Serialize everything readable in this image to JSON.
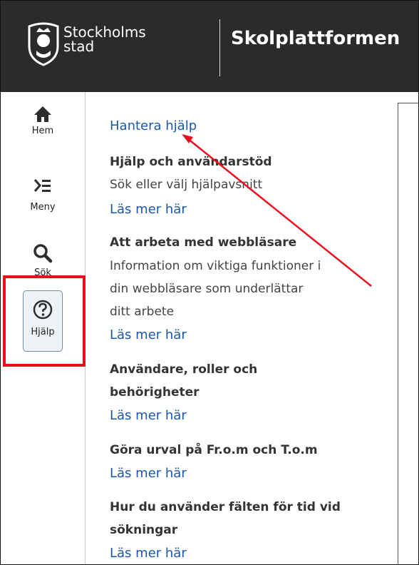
{
  "header": {
    "logo_line1": "Stockholms",
    "logo_line2": "stad",
    "app_title": "Skolplattformen"
  },
  "sidebar": {
    "items": [
      {
        "label": "Hem",
        "icon": "home-icon"
      },
      {
        "label": "Meny",
        "icon": "menu-icon"
      },
      {
        "label": "Sök",
        "icon": "search-icon"
      },
      {
        "label": "Hjälp",
        "icon": "help-icon"
      }
    ]
  },
  "help": {
    "manage_link": "Hantera hjälp",
    "sections": [
      {
        "title": "Hjälp och användarstöd",
        "desc": [
          "Sök eller välj hjälpavsnitt"
        ],
        "link": "Läs mer här"
      },
      {
        "title": "Att arbeta med webbläsare",
        "desc": [
          "Information om viktiga funktioner i",
          "din webbläsare som underlättar",
          "ditt arbete"
        ],
        "link": "Läs mer här"
      },
      {
        "title": "Användare, roller och",
        "title2": "behörigheter",
        "desc": [],
        "link": "Läs mer här"
      },
      {
        "title": "Göra urval på Fr.o.m och T.o.m",
        "desc": [],
        "link": "Läs mer här"
      },
      {
        "title": "Hur du använder fälten för tid vid",
        "title2": "sökningar",
        "desc": [],
        "link": "Läs mer här"
      }
    ]
  },
  "colors": {
    "header_bg": "#2b2b2b",
    "link": "#1b57a6",
    "highlight": "#e8101c"
  }
}
